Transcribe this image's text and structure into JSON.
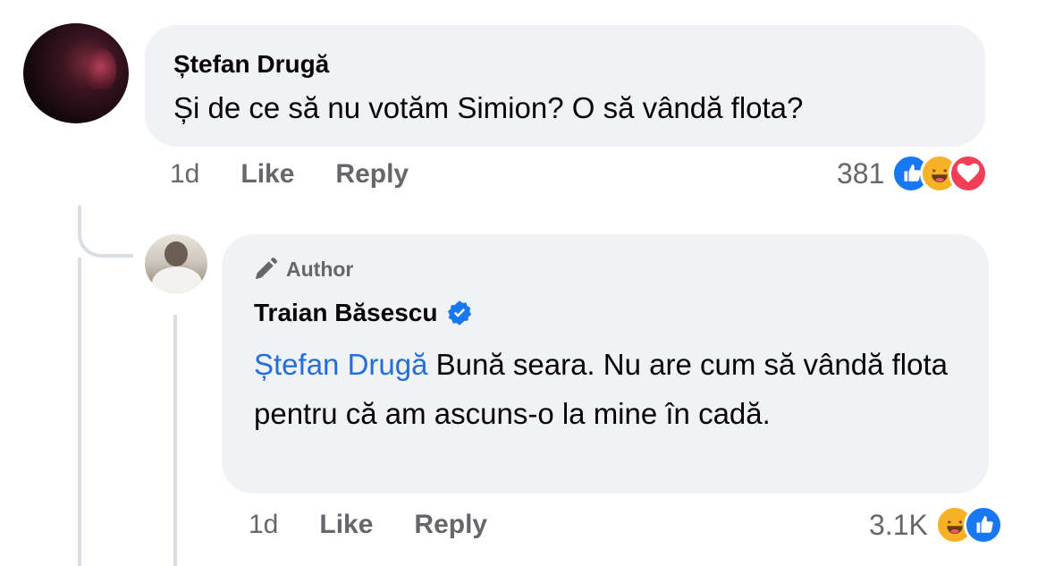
{
  "comment": {
    "author": "Ștefan Drugă",
    "text": "Și de ce să nu votăm Simion? O să vândă flota?",
    "time": "1d",
    "like_label": "Like",
    "reply_label": "Reply",
    "reaction_count": "381",
    "reactions": [
      "like-icon",
      "haha-icon",
      "love-icon"
    ]
  },
  "reply": {
    "badge": "Author",
    "author": "Traian Băsescu",
    "verified": true,
    "mention": "Ștefan Drugă",
    "text": " Bună seara. Nu are cum să vândă flota pentru că am ascuns-o la mine în cadă.",
    "time": "1d",
    "like_label": "Like",
    "reply_label": "Reply",
    "reaction_count": "3.1K",
    "reactions": [
      "haha-icon",
      "like-icon"
    ]
  },
  "colors": {
    "bubble": "#f0f2f5",
    "meta_text": "#65676b",
    "mention": "#216fdb",
    "like": "#1877f2",
    "haha": "#f7b125",
    "love": "#f33e58",
    "verified": "#1877f2"
  }
}
